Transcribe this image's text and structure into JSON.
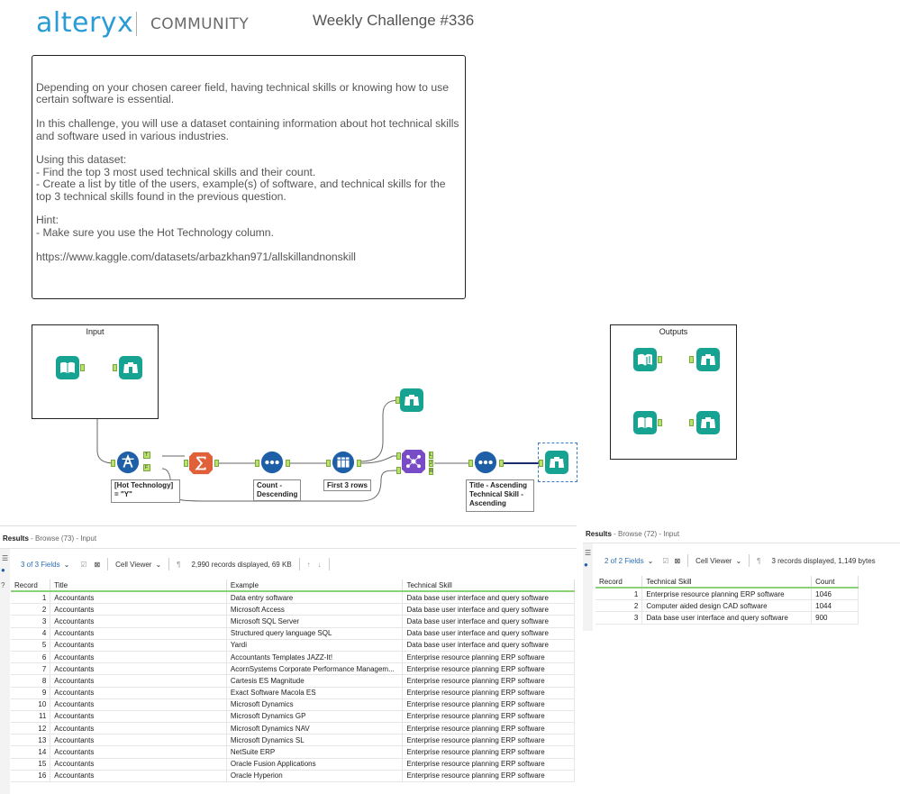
{
  "header": {
    "logo": "alteryx",
    "community": "COMMUNITY",
    "challenge_title": "Weekly Challenge #336"
  },
  "description": {
    "paragraphs": [
      "Depending on your chosen career field, having technical skills or knowing how to use certain software is essential.",
      "In this challenge, you will use a dataset containing information about hot technical skills and software used in various industries.",
      "Using this dataset:\n- Find the top 3 most used technical skills and their count.\n- Create a list by title of the users, example(s) of software, and technical skills for the top 3 technical skills found in the previous question.",
      "Hint:\n- Make sure you use the Hot Technology column.",
      "",
      "https://www.kaggle.com/datasets/arbazkhan971/allskillandnonskill"
    ]
  },
  "workflow": {
    "input_container": "Input",
    "outputs_container": "Outputs",
    "annotations": {
      "filter": "[Hot Technology]\n= \"Y\"",
      "sort1": "Count -\nDescending",
      "sample": "First 3 rows",
      "sort2": "Title - Ascending\nTechnical Skill -\nAscending"
    },
    "anchor_labels": {
      "filter_true": "T",
      "filter_false": "F",
      "join_left": "L",
      "join_join": "J",
      "join_right": "R"
    },
    "colors": {
      "input": "#17a392",
      "browse": "#17a392",
      "filter": "#1f5fa8",
      "summarize": "#e0603a",
      "sort": "#1f5fa8",
      "sample": "#1f5fa8",
      "join": "#7a4bc7",
      "anchor": "#b9e26a"
    }
  },
  "results_left": {
    "title": "Results",
    "subtitle": "- Browse (73) - Input",
    "fields": "3 of 3 Fields",
    "viewer": "Cell Viewer",
    "status": "2,990 records displayed, 69 KB",
    "columns": [
      "Record",
      "Title",
      "Example",
      "Technical Skill"
    ],
    "rows": [
      [
        "1",
        "Accountants",
        "Data entry software",
        "Data base user interface and query software"
      ],
      [
        "2",
        "Accountants",
        "Microsoft Access",
        "Data base user interface and query software"
      ],
      [
        "3",
        "Accountants",
        "Microsoft SQL Server",
        "Data base user interface and query software"
      ],
      [
        "4",
        "Accountants",
        "Structured query language SQL",
        "Data base user interface and query software"
      ],
      [
        "5",
        "Accountants",
        "Yardi",
        "Data base user interface and query software"
      ],
      [
        "6",
        "Accountants",
        "Accountants Templates JAZZ-It!",
        "Enterprise resource planning ERP software"
      ],
      [
        "7",
        "Accountants",
        "AcornSystems Corporate Performance Managem...",
        "Enterprise resource planning ERP software"
      ],
      [
        "8",
        "Accountants",
        "Cartesis ES Magnitude",
        "Enterprise resource planning ERP software"
      ],
      [
        "9",
        "Accountants",
        "Exact Software Macola ES",
        "Enterprise resource planning ERP software"
      ],
      [
        "10",
        "Accountants",
        "Microsoft Dynamics",
        "Enterprise resource planning ERP software"
      ],
      [
        "11",
        "Accountants",
        "Microsoft Dynamics GP",
        "Enterprise resource planning ERP software"
      ],
      [
        "12",
        "Accountants",
        "Microsoft Dynamics NAV",
        "Enterprise resource planning ERP software"
      ],
      [
        "13",
        "Accountants",
        "Microsoft Dynamics SL",
        "Enterprise resource planning ERP software"
      ],
      [
        "14",
        "Accountants",
        "NetSuite ERP",
        "Enterprise resource planning ERP software"
      ],
      [
        "15",
        "Accountants",
        "Oracle Fusion Applications",
        "Enterprise resource planning ERP software"
      ],
      [
        "16",
        "Accountants",
        "Oracle Hyperion",
        "Enterprise resource planning ERP software"
      ]
    ]
  },
  "results_right": {
    "title": "Results",
    "subtitle": "- Browse (72) - Input",
    "fields": "2 of 2 Fields",
    "viewer": "Cell Viewer",
    "status": "3 records displayed, 1,149 bytes",
    "columns": [
      "Record",
      "Technical Skill",
      "Count"
    ],
    "rows": [
      [
        "1",
        "Enterprise resource planning ERP software",
        "1046"
      ],
      [
        "2",
        "Computer aided design CAD software",
        "1044"
      ],
      [
        "3",
        "Data base user interface and query software",
        "900"
      ]
    ]
  }
}
